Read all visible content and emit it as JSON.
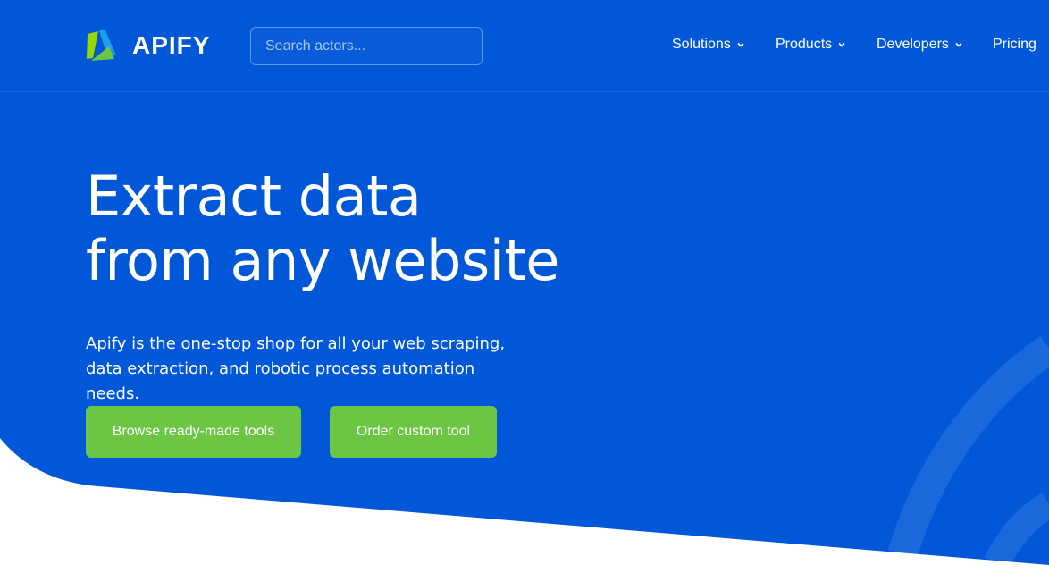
{
  "colors": {
    "hero_blue": "#0057d8",
    "button_green": "#6cc644",
    "text": "#ffffff"
  },
  "brand": {
    "name": "APIFY",
    "logo_icon": "apify-logo-icon"
  },
  "search": {
    "placeholder": "Search actors..."
  },
  "nav": {
    "items": [
      {
        "label": "Solutions",
        "has_dropdown": true
      },
      {
        "label": "Products",
        "has_dropdown": true
      },
      {
        "label": "Developers",
        "has_dropdown": true
      },
      {
        "label": "Pricing",
        "has_dropdown": false
      }
    ]
  },
  "hero": {
    "headline_lines": [
      "Extract data",
      "from any website"
    ],
    "subtitle_lines": [
      "Apify is the one-stop shop for all your web scraping,",
      "data extraction, and robotic process automation needs."
    ],
    "buttons": {
      "browse": "Browse ready-made tools",
      "order": "Order custom tool"
    }
  }
}
